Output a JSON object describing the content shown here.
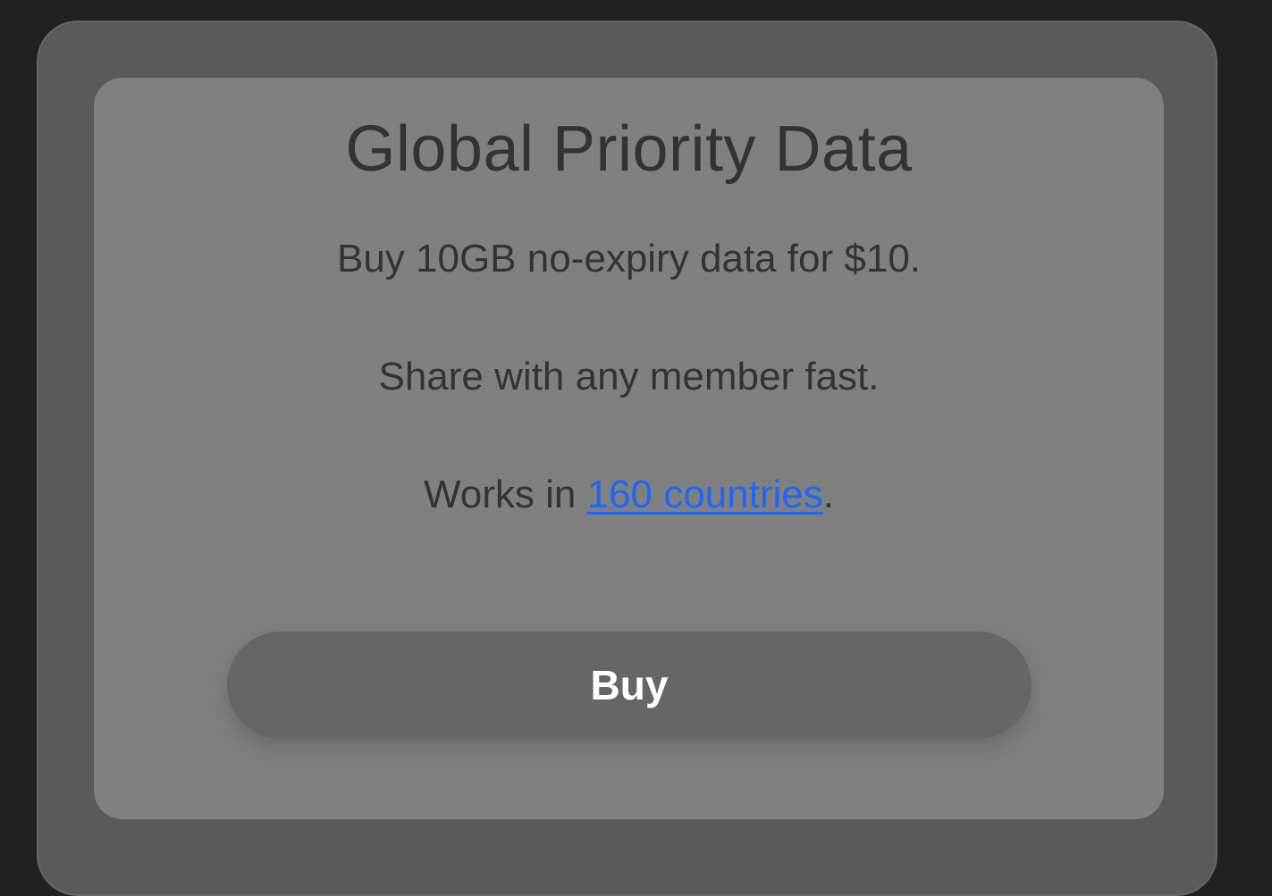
{
  "offer": {
    "title": "Global Priority Data",
    "line_1": "Buy 10GB no-expiry data for $10.",
    "line_2": "Share with any member fast.",
    "line_3_prefix": "Works in ",
    "line_3_link": "160 countries",
    "line_3_suffix": ".",
    "buy_button_label": "Buy"
  },
  "colors": {
    "page_background": "#212121",
    "outer_card": "#5a5a5a",
    "inner_card": "#808080",
    "text": "#333333",
    "link": "#1a66ff",
    "button": "#666666",
    "button_text": "#ffffff"
  }
}
